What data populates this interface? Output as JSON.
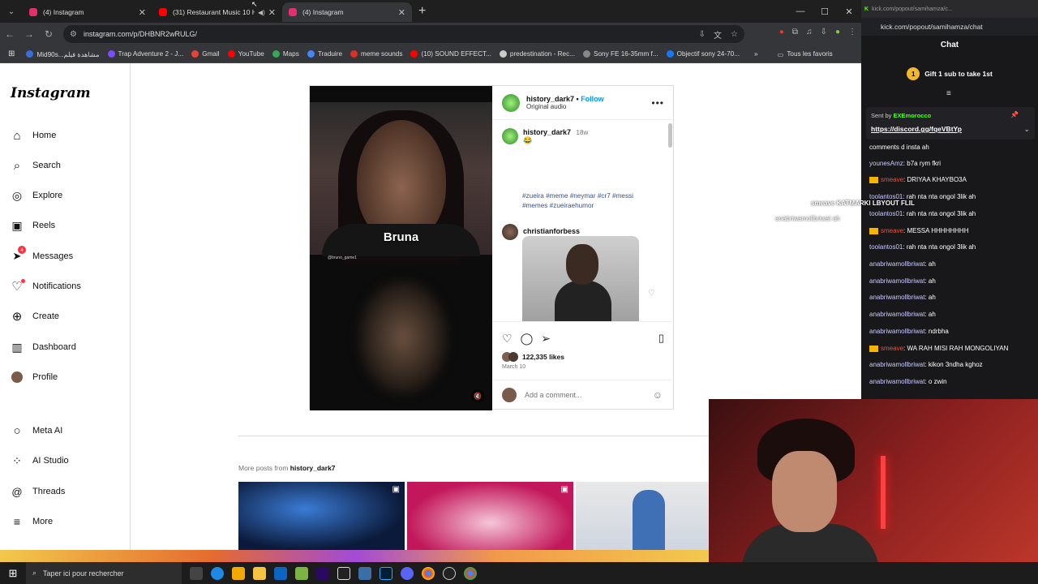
{
  "browser": {
    "tabs": [
      {
        "title": "(4) Instagram",
        "favicon_color": "#e1306c"
      },
      {
        "title": "(31) Restaurant Music 10 H",
        "favicon_color": "#ff0000"
      },
      {
        "title": "(4) Instagram",
        "favicon_color": "#e1306c"
      }
    ],
    "url": "instagram.com/p/DHBNR2wRULG/",
    "bookmarks": [
      {
        "label": "Mid90s...مشاهدة فيلم",
        "color": "#3a6ed8"
      },
      {
        "label": "Trap Adventure 2 - J...",
        "color": "#7c4dff"
      },
      {
        "label": "Gmail",
        "color": "#ea4335"
      },
      {
        "label": "YouTube",
        "color": "#ff0000"
      },
      {
        "label": "Maps",
        "color": "#34a853"
      },
      {
        "label": "Traduire",
        "color": "#4285f4"
      },
      {
        "label": "meme sounds",
        "color": "#d93025"
      },
      {
        "label": "(10) SOUND EFFECT...",
        "color": "#ff0000"
      },
      {
        "label": "predestination - Rec...",
        "color": "#cccccc"
      },
      {
        "label": "Sony FE 16-35mm f...",
        "color": "#888888"
      },
      {
        "label": "Objectif sony 24-70...",
        "color": "#1877f2"
      }
    ],
    "bookmarks_all": "Tous les favoris"
  },
  "instagram": {
    "logo": "Instagram",
    "nav": [
      {
        "label": "Home",
        "icon": "⌂"
      },
      {
        "label": "Search",
        "icon": "⌕"
      },
      {
        "label": "Explore",
        "icon": "◎"
      },
      {
        "label": "Reels",
        "icon": "▣"
      },
      {
        "label": "Messages",
        "icon": "➤",
        "badge": "4"
      },
      {
        "label": "Notifications",
        "icon": "♡"
      },
      {
        "label": "Create",
        "icon": "⊕"
      },
      {
        "label": "Dashboard",
        "icon": "▥"
      },
      {
        "label": "Profile",
        "icon": "●"
      }
    ],
    "nav_bottom": [
      {
        "label": "Meta AI",
        "icon": "○"
      },
      {
        "label": "AI Studio",
        "icon": "⁘"
      },
      {
        "label": "Threads",
        "icon": "@"
      },
      {
        "label": "More",
        "icon": "≡"
      }
    ],
    "post": {
      "video_caption": "Bruna",
      "video_tag": "@bruno_game1",
      "username": "history_dark7",
      "follow": "Follow",
      "audio": "Original audio",
      "caption_user": "history_dark7",
      "caption_time": "18w",
      "caption_emoji": "😂",
      "hashtags": "#zueira #meme #neymar #cr7 #messi #memes #zueiraehumor",
      "comment_user": "christianforbess",
      "likes": "122,335 likes",
      "date": "March 10",
      "add_comment_placeholder": "Add a comment..."
    },
    "more_posts_prefix": "More posts from ",
    "more_posts_user": "history_dark7"
  },
  "kick": {
    "tab_title": "kick.com/popout/samihamza/c...",
    "url": "kick.com/popout/samihamza/chat",
    "header": "Chat",
    "gift": "Gift 1 sub to take 1st",
    "pinned_sender_prefix": "Sent by",
    "pinned_sender": "EXEmorocco",
    "pinned_link": "https://discord.gg/fqeVBtYp",
    "messages": [
      {
        "user": "",
        "text": "comments d insta ah",
        "style": "plain"
      },
      {
        "user": "younesAmz",
        "text": ": b7a rym fkri",
        "style": "purple"
      },
      {
        "user": "smeave",
        "text": ": DRIYAA KHAYBO3A",
        "style": "gold"
      },
      {
        "user": "toolantos01",
        "text": ": rah nta nta ongol 3lik ah",
        "style": "purple"
      },
      {
        "user": "toolantos01",
        "text": ": rah nta nta ongol 3lik ah",
        "style": "purple"
      },
      {
        "user": "smeave",
        "text": ": MESSA HHHHHHHH",
        "style": "gold"
      },
      {
        "user": "toolantos01",
        "text": ": rah nta nta ongol 3lik ah",
        "style": "purple"
      },
      {
        "user": "anabriwamollbriwat",
        "text": ": ah",
        "style": "purple"
      },
      {
        "user": "anabriwamollbriwat",
        "text": ": ah",
        "style": "purple"
      },
      {
        "user": "anabriwamollbriwat",
        "text": ": ah",
        "style": "purple"
      },
      {
        "user": "anabriwamollbriwat",
        "text": ": ah",
        "style": "purple"
      },
      {
        "user": "anabriwamollbriwat",
        "text": ": ndrbha",
        "style": "purple"
      },
      {
        "user": "smeave",
        "text": ": WA RAH MISI RAH MONGOLIYAN",
        "style": "gold"
      },
      {
        "user": "anabriwamollbriwat",
        "text": ": kikon 3ndha kghoz",
        "style": "purple"
      },
      {
        "user": "anabriwamollbriwat",
        "text": ": o zwin",
        "style": "purple"
      }
    ],
    "overlay1": "smeave KATMARKI LBYOUT FLIL",
    "overlay2": "anabriwamollbriwat ah"
  },
  "taskbar": {
    "search_placeholder": "Taper ici pour rechercher"
  }
}
